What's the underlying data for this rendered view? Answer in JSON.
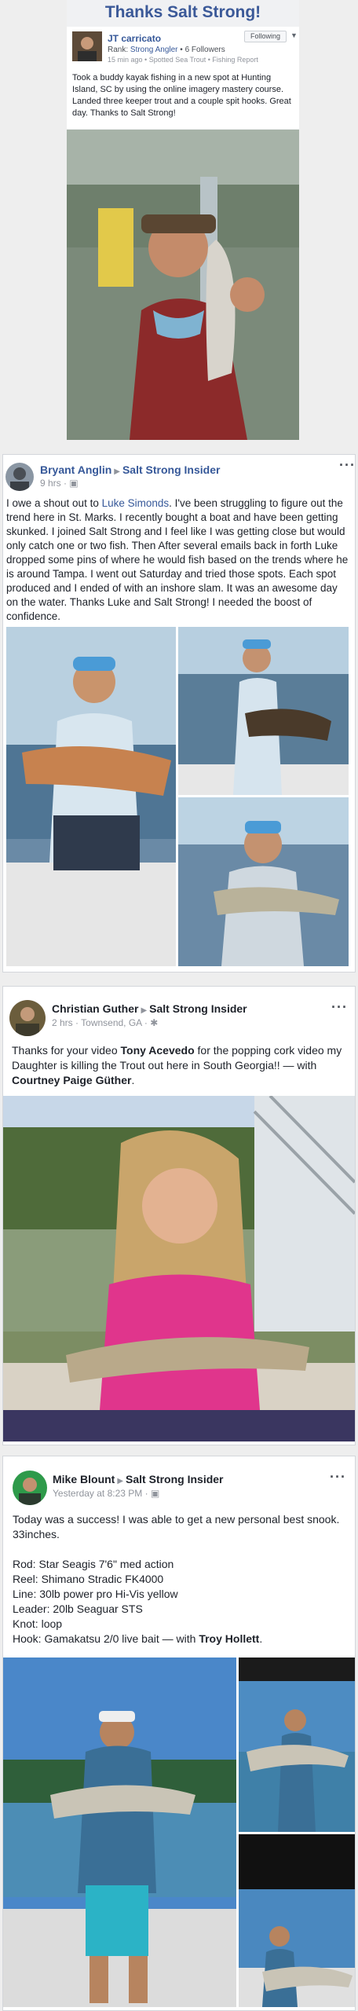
{
  "post1": {
    "title": "Thanks Salt Strong!",
    "author": "JT carricato",
    "follow_label": "Following",
    "rank_prefix": "Rank:",
    "rank": "Strong Angler",
    "followers": "6 Followers",
    "time": "15 min ago",
    "category": "Spotted Sea Trout",
    "type": "Fishing Report",
    "text": "Took a buddy kayak fishing in a new spot at Hunting Island, SC by using the online imagery mastery course. Landed three keeper trout and a couple spit hooks. Great day. Thanks to Salt Strong!"
  },
  "post2": {
    "author": "Bryant Anglin",
    "group": "Salt Strong Insider",
    "time": "9 hrs",
    "text_1": "I owe a shout out to ",
    "mention": "Luke Simonds",
    "text_2": ". I've been struggling to figure out the trend here in St. Marks. I recently bought a boat and have been getting skunked. I joined Salt Strong and I feel like I was getting close but would only catch one or two fish. Then After several emails back in forth Luke dropped some pins of where he would fish based on the trends where he is around Tampa. I went out Saturday and tried those spots. Each spot produced and I ended of with an inshore slam. It was an awesome day on the water. Thanks Luke and Salt Strong! I needed the boost of confidence."
  },
  "post3": {
    "author": "Christian Guther",
    "group": "Salt Strong Insider",
    "time": "2 hrs",
    "location": "Townsend, GA",
    "text_1": "Thanks for your video ",
    "mention_1": "Tony Acevedo",
    "text_2": " for the popping cork video my Daughter is killing the Trout out here in South Georgia!! — with ",
    "mention_2": "Courtney Paige Güther",
    "text_3": "."
  },
  "post4": {
    "author": "Mike Blount",
    "group": "Salt Strong Insider",
    "time": "Yesterday at 8:23 PM",
    "line_1": "Today was a success! I was able to get a new personal best snook. 33inches.",
    "rod": "Rod: Star Seagis 7'6\" med action",
    "reel": "Reel: Shimano Stradic FK4000",
    "line": "Line: 30lb power pro Hi-Vis yellow",
    "leader": "Leader: 20lb Seaguar STS",
    "knot": "Knot: loop",
    "hook_text": "Hook: Gamakatsu 2/0 live bait — with ",
    "mention": "Troy Hollett",
    "end": "."
  },
  "colors": {
    "link": "#365899",
    "title": "#3b5998",
    "meta": "#90949c"
  }
}
